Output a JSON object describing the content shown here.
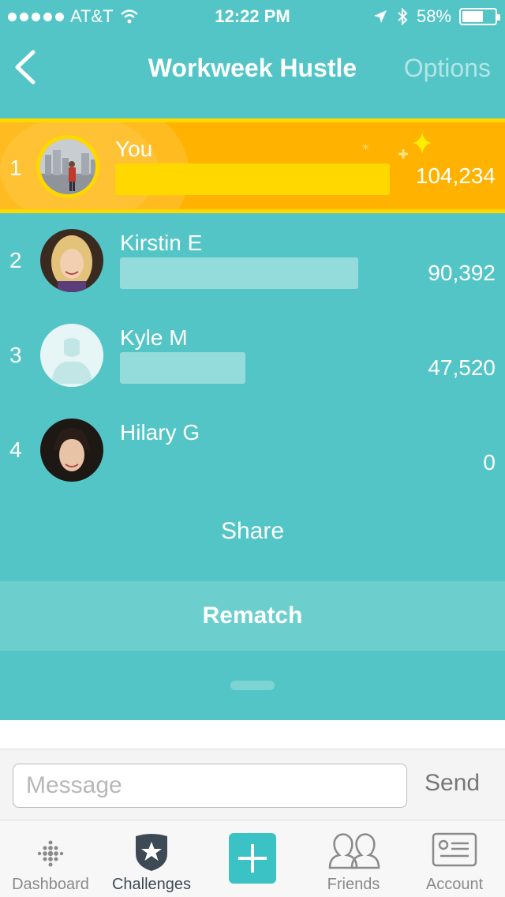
{
  "status_bar": {
    "carrier": "AT&T",
    "time": "12:22 PM",
    "battery": "58%",
    "battery_level": 0.58,
    "icons": [
      "signal-dots-icon",
      "wifi-icon",
      "location-arrow-icon",
      "bluetooth-icon",
      "battery-icon"
    ]
  },
  "nav": {
    "title": "Workweek Hustle",
    "options_label": "Options",
    "back_icon": "chevron-left-icon"
  },
  "leaderboard": [
    {
      "rank": "1",
      "name": "You",
      "steps": "104,234",
      "progress": 1.0
    },
    {
      "rank": "2",
      "name": "Kirstin E",
      "steps": "90,392",
      "progress": 0.867
    },
    {
      "rank": "3",
      "name": "Kyle M",
      "steps": "47,520",
      "progress": 0.456
    },
    {
      "rank": "4",
      "name": "Hilary G",
      "steps": "0",
      "progress": 0
    }
  ],
  "actions": {
    "share_label": "Share",
    "rematch_label": "Rematch"
  },
  "message": {
    "placeholder": "Message",
    "send_label": "Send"
  },
  "tabbar": {
    "items": [
      {
        "label": "Dashboard",
        "icon": "fitbit-dots-icon"
      },
      {
        "label": "Challenges",
        "icon": "badge-star-icon",
        "active": true
      },
      {
        "label": "",
        "icon": "plus-icon"
      },
      {
        "label": "Friends",
        "icon": "friends-icon"
      },
      {
        "label": "Account",
        "icon": "id-card-icon"
      }
    ]
  },
  "colors": {
    "teal": "#54c5c6",
    "leader_gold": "#ffb200",
    "leader_bar": "#ffd800",
    "bar_light": "#93dcdb"
  }
}
